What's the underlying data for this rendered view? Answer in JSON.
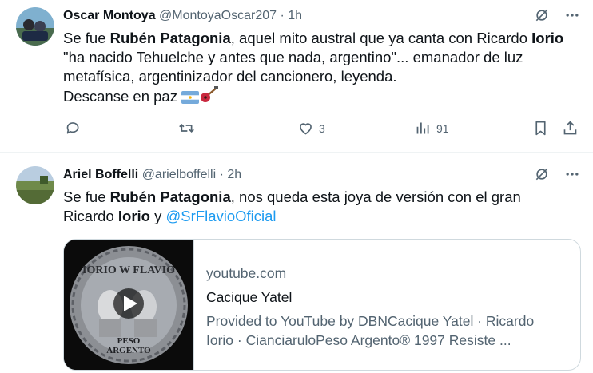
{
  "tweets": [
    {
      "name": "Oscar Montoya",
      "handle": "@MontoyaOscar207",
      "sep": "·",
      "time": "1h",
      "line1_a": "Se fue ",
      "line1_b": "Rubén Patagonia",
      "line1_c": ", aquel mito austral que ya canta con Ricardo ",
      "line1_d": "Iorio",
      "line2": "\"ha nacido Tehuelche y antes que nada, argentino\"... emanador de luz",
      "line3": "metafísica, argentinizador del cancionero, leyenda.",
      "line4": "Descanse en paz ",
      "likes": "3",
      "views": "91"
    },
    {
      "name": "Ariel Boffelli",
      "handle": "@arielboffelli",
      "sep": "·",
      "time": "2h",
      "line1_a": "Se fue ",
      "line1_b": "Rubén Patagonia",
      "line1_c": ", nos queda esta joya de versión con el gran",
      "line2_a": "Ricardo ",
      "line2_b": "Iorio",
      "line2_c": " y ",
      "mention": "@SrFlavioOficial",
      "card": {
        "thumb_top_text": "IORIO W FLAVIO",
        "thumb_bottom_1": "PESO",
        "thumb_bottom_2": "ARGENTO",
        "domain": "youtube.com",
        "title": "Cacique Yatel",
        "desc_line1": "Provided to YouTube by DBNCacique Yatel · Ricardo",
        "desc_line2": "Iorio · CianciaruloPeso Argento® 1997 Resiste ..."
      }
    }
  ],
  "icons": [
    "grok-icon",
    "more-icon",
    "reply-icon",
    "retweet-icon",
    "like-icon",
    "views-icon",
    "bookmark-icon",
    "share-icon",
    "argentina-flag-icon",
    "guitar-icon",
    "play-icon"
  ],
  "colors": {
    "link": "#1d9bf0",
    "muted": "#536471",
    "text": "#0f1419",
    "divider": "#eff3f4"
  }
}
